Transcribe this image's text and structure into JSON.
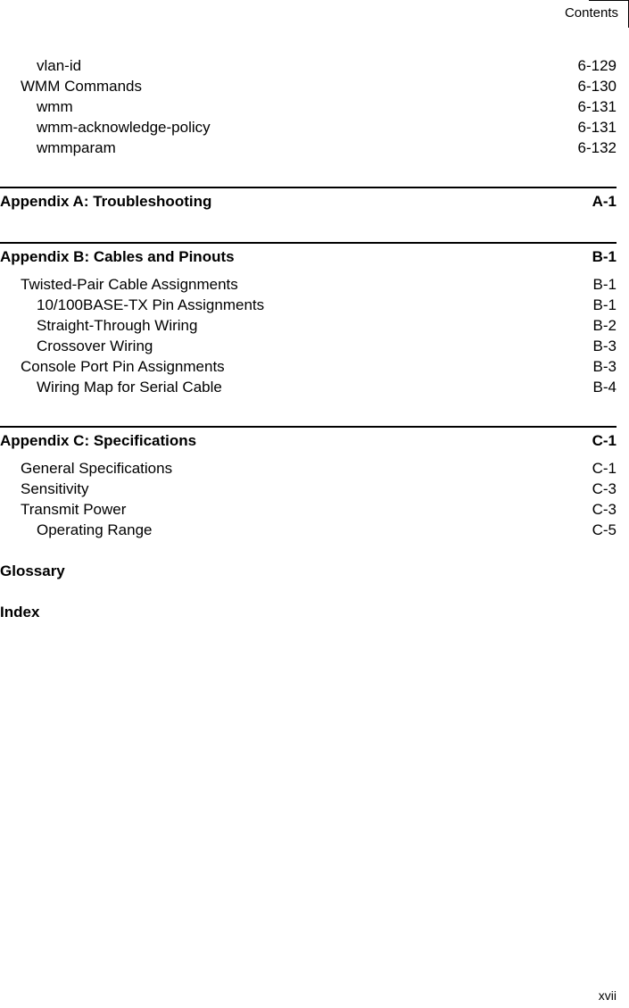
{
  "header": {
    "label": "Contents"
  },
  "entries_top": [
    {
      "title": "vlan-id",
      "page": "6-129",
      "level": 2
    },
    {
      "title": "WMM Commands",
      "page": "6-130",
      "level": 1
    },
    {
      "title": "wmm",
      "page": "6-131",
      "level": 2
    },
    {
      "title": "wmm-acknowledge-policy",
      "page": "6-131",
      "level": 2
    },
    {
      "title": "wmmparam",
      "page": "6-132",
      "level": 2
    }
  ],
  "appendix_a": {
    "title": "Appendix A: Troubleshooting",
    "page": "A-1"
  },
  "appendix_b": {
    "title": "Appendix B: Cables and Pinouts",
    "page": "B-1",
    "entries": [
      {
        "title": "Twisted-Pair Cable Assignments",
        "page": "B-1"
      },
      {
        "title": "10/100BASE-TX Pin Assignments",
        "page": "B-1"
      },
      {
        "title": "Straight-Through Wiring",
        "page": "B-2"
      },
      {
        "title": "Crossover Wiring",
        "page": "B-3"
      },
      {
        "title": "Console Port Pin Assignments",
        "page": "B-3"
      },
      {
        "title": "Wiring Map for Serial Cable",
        "page": "B-4"
      }
    ]
  },
  "appendix_c": {
    "title": "Appendix C: Specifications",
    "page": "C-1",
    "entries": [
      {
        "title": "General Specifications",
        "page": "C-1"
      },
      {
        "title": "Sensitivity",
        "page": "C-3"
      },
      {
        "title": "Transmit Power",
        "page": "C-3"
      },
      {
        "title": "Operating Range",
        "page": "C-5"
      }
    ]
  },
  "glossary": {
    "title": "Glossary"
  },
  "index": {
    "title": "Index"
  },
  "footer": {
    "page_number": "xvii"
  }
}
